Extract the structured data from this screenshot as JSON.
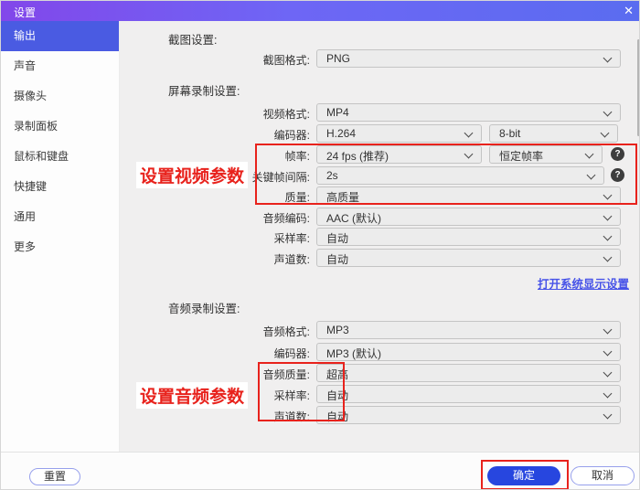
{
  "window": {
    "title": "设置",
    "close_icon": "✕"
  },
  "sidebar": {
    "selected": "输出",
    "items": [
      {
        "label": "输出"
      },
      {
        "label": "声音"
      },
      {
        "label": "摄像头"
      },
      {
        "label": "录制面板"
      },
      {
        "label": "鼠标和键盘"
      },
      {
        "label": "快捷键"
      },
      {
        "label": "通用"
      },
      {
        "label": "更多"
      }
    ]
  },
  "screenshot_section": {
    "header": "截图设置:",
    "format": {
      "label": "截图格式:",
      "value": "PNG"
    }
  },
  "screen_recording_section": {
    "header": "屏幕录制设置:",
    "rows": {
      "video_format": {
        "label": "视频格式:",
        "value": "MP4"
      },
      "encoder": {
        "label": "编码器:",
        "value": "H.264",
        "value2": "8-bit"
      },
      "framerate": {
        "label": "帧率:",
        "value": "24 fps (推荐)",
        "value2": "恒定帧率"
      },
      "keyframe_interval": {
        "label": "关键帧间隔:",
        "value": "2s"
      },
      "quality": {
        "label": "质量:",
        "value": "高质量"
      },
      "audio_codec": {
        "label": "音频编码:",
        "value": "AAC (默认)"
      },
      "sample_rate": {
        "label": "采样率:",
        "value": "自动"
      },
      "channels": {
        "label": "声道数:",
        "value": "自动"
      }
    },
    "link": "打开系统显示设置"
  },
  "audio_recording_section": {
    "header": "音频录制设置:",
    "rows": {
      "audio_format": {
        "label": "音频格式:",
        "value": "MP3"
      },
      "encoder": {
        "label": "编码器:",
        "value": "MP3 (默认)"
      },
      "audio_quality": {
        "label": "音频质量:",
        "value": "超高"
      },
      "sample_rate": {
        "label": "采样率:",
        "value": "自动"
      },
      "channels": {
        "label": "声道数:",
        "value": "自动"
      }
    }
  },
  "annotations": {
    "video_note": "设置视频参数",
    "audio_note": "设置音频参数"
  },
  "footer": {
    "reset": "重置",
    "ok": "确定",
    "cancel": "取消"
  },
  "help_icon": "?",
  "colors": {
    "titlebar_left": "#8247ea",
    "titlebar_right": "#5a6cf0",
    "sidebar_selected": "#4a5be2",
    "ok_button": "#2746df",
    "link": "#4753e8",
    "annotation_red": "#e8221c"
  }
}
